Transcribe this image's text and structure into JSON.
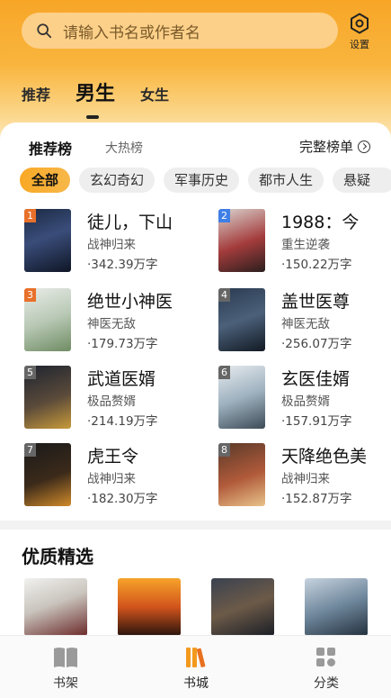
{
  "search": {
    "placeholder": "请输入书名或作者名"
  },
  "settings": {
    "label": "设置"
  },
  "genre_tabs": [
    "推荐",
    "男生",
    "女生"
  ],
  "rank_tabs": {
    "active": "推荐榜",
    "other": "大热榜"
  },
  "full_list": "完整榜单",
  "chips": [
    "全部",
    "玄幻奇幻",
    "军事历史",
    "都市人生",
    "悬疑"
  ],
  "books": [
    {
      "rank": "1",
      "title": "徒儿，下山",
      "category": "战神归来",
      "words": "·342.39万字"
    },
    {
      "rank": "2",
      "title": "1988：今",
      "category": "重生逆袭",
      "words": "·150.22万字"
    },
    {
      "rank": "3",
      "title": "绝世小神医",
      "category": "神医无敌",
      "words": "·179.73万字"
    },
    {
      "rank": "4",
      "title": "盖世医尊",
      "category": "神医无敌",
      "words": "·256.07万字"
    },
    {
      "rank": "5",
      "title": "武道医婿",
      "category": "极品赘婿",
      "words": "·214.19万字"
    },
    {
      "rank": "6",
      "title": "玄医佳婿",
      "category": "极品赘婿",
      "words": "·157.91万字"
    },
    {
      "rank": "7",
      "title": "虎王令",
      "category": "战神归来",
      "words": "·182.30万字"
    },
    {
      "rank": "8",
      "title": "天降绝色美",
      "category": "战神归来",
      "words": "·152.87万字"
    }
  ],
  "section": {
    "title": "优质精选"
  },
  "nav": [
    {
      "label": "书架",
      "icon": "book-icon"
    },
    {
      "label": "书城",
      "icon": "bookstore-icon"
    },
    {
      "label": "分类",
      "icon": "grid-icon"
    }
  ],
  "colors": {
    "accent": "#f9a825",
    "rank_top": "#f57c00",
    "rank_blue": "#3f7fe6",
    "rank_gray": "#666666"
  }
}
